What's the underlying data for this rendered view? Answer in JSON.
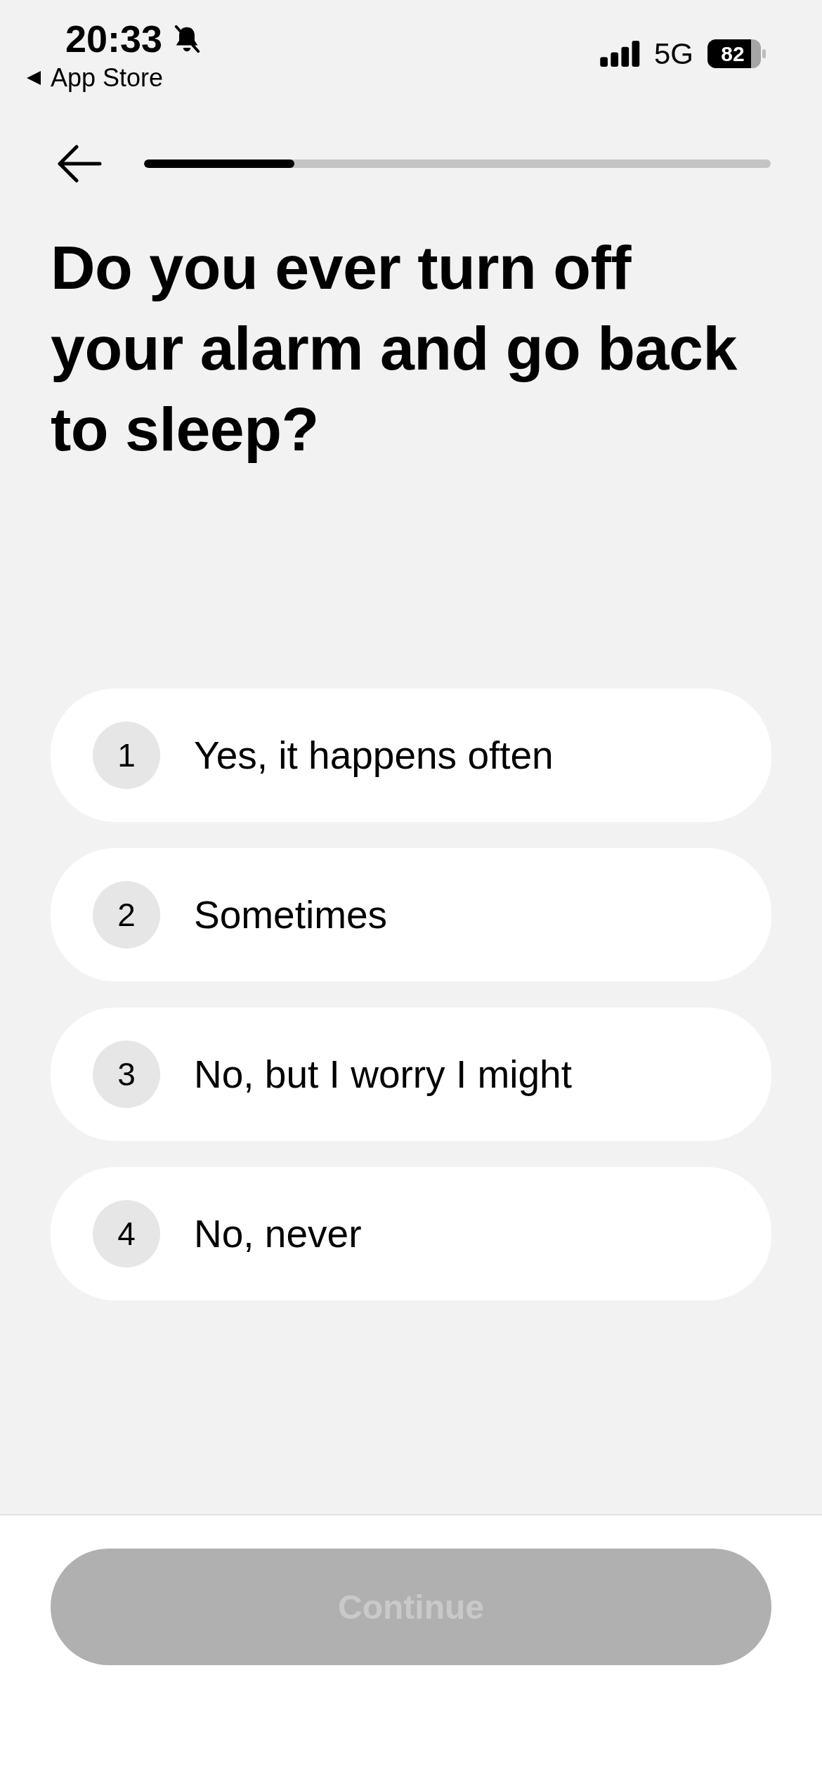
{
  "status_bar": {
    "time": "20:33",
    "back_to_app": "App Store",
    "network": "5G",
    "battery": "82"
  },
  "progress": {
    "level": 0.24
  },
  "question": "Do you ever turn off your alarm and go back to sleep?",
  "options": [
    {
      "number": "1",
      "label": "Yes, it happens often",
      "selected": false
    },
    {
      "number": "2",
      "label": "Sometimes",
      "selected": false
    },
    {
      "number": "3",
      "label": "No, but I worry I might",
      "selected": false
    },
    {
      "number": "4",
      "label": "No, never",
      "selected": false
    }
  ],
  "continue_button": {
    "label": "Continue",
    "disabled": true
  }
}
